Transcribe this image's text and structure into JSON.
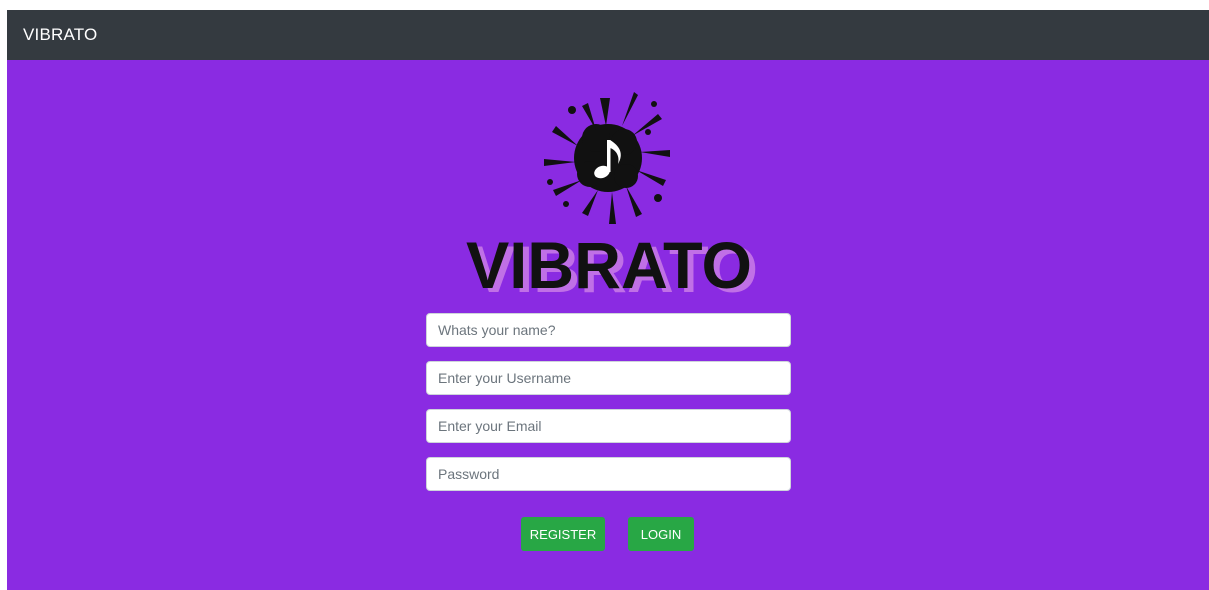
{
  "navbar": {
    "brand": "VIBRATO",
    "background": "#343a40"
  },
  "logo": {
    "wordmark": "VIBRATO",
    "icon": "music-note-splat-icon"
  },
  "form": {
    "name": {
      "placeholder": "Whats your name?",
      "value": ""
    },
    "username": {
      "placeholder": "Enter your Username",
      "value": ""
    },
    "email": {
      "placeholder": "Enter your Email",
      "value": ""
    },
    "password": {
      "placeholder": "Password",
      "value": ""
    }
  },
  "buttons": {
    "register": "REGISTER",
    "login": "LOGIN"
  },
  "colors": {
    "page_background": "#8a2be2",
    "button_green": "#28a745",
    "navbar": "#343a40"
  }
}
